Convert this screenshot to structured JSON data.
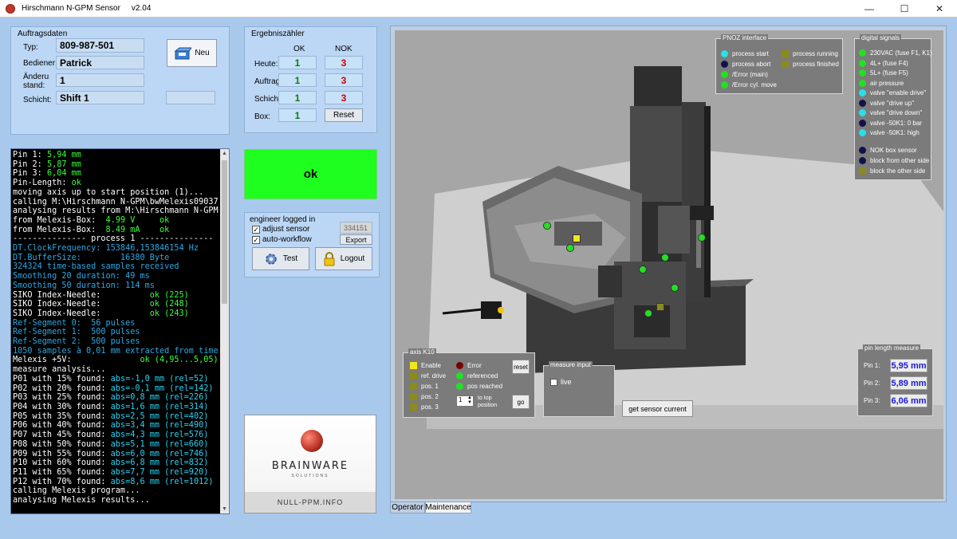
{
  "window": {
    "title": "Hirschmann N-GPM Sensor",
    "version": "v2.04",
    "minimize": "—",
    "maximize": "☐",
    "close": "✕"
  },
  "order": {
    "title": "Auftragsdaten",
    "type_label": "Typ:",
    "type_value": "809-987-501",
    "operator_label": "Bediener:",
    "operator_value": "Patrick",
    "change_label": "Änderu stand:",
    "change_value": "1",
    "shift_label": "Schicht:",
    "shift_value": "Shift 1",
    "new_button": "Neu"
  },
  "counter": {
    "title": "Ergebniszähler",
    "ok_header": "OK",
    "nok_header": "NOK",
    "rows": [
      {
        "label": "Heute:",
        "ok": "1",
        "nok": "3"
      },
      {
        "label": "Auftrag:",
        "ok": "1",
        "nok": "3"
      },
      {
        "label": "Schicht:",
        "ok": "1",
        "nok": "3"
      }
    ],
    "box_label": "Box:",
    "box_value": "1",
    "reset_button": "Reset"
  },
  "log": [
    {
      "t": "Pin 1: ",
      "c": "w",
      "v": "5,94 mm",
      "vc": "g"
    },
    {
      "t": "Pin 2: ",
      "c": "w",
      "v": "5,87 mm",
      "vc": "g"
    },
    {
      "t": "Pin 3: ",
      "c": "w",
      "v": "6,04 mm",
      "vc": "g"
    },
    {
      "t": "Pin-Length: ",
      "c": "w",
      "v": "ok",
      "vc": "g"
    },
    {
      "t": "moving axis up to start position (1)...",
      "c": "w",
      "v": "",
      "vc": "w"
    },
    {
      "t": "calling M:\\Hirschmann N-GPM\\bwMelexis09037",
      "c": "w",
      "v": "",
      "vc": "w"
    },
    {
      "t": "analysing results from M:\\Hirschmann N-GPM",
      "c": "w",
      "v": "",
      "vc": "w"
    },
    {
      "t": "from Melexis-Box:  ",
      "c": "w",
      "v": "4.99 V     ok",
      "vc": "g"
    },
    {
      "t": "from Melexis-Box:  ",
      "c": "w",
      "v": "8.49 mA    ok",
      "vc": "g"
    },
    {
      "t": "--------------- process 1 ---------------",
      "c": "w",
      "v": "",
      "vc": "w"
    },
    {
      "t": "DT.ClockFrequency: 153846,153846154 Hz",
      "c": "b",
      "v": "",
      "vc": "w"
    },
    {
      "t": "DT.BufferSize:        16380 Byte",
      "c": "b",
      "v": "",
      "vc": "w"
    },
    {
      "t": "324324 time-based samples received",
      "c": "b",
      "v": "",
      "vc": "w"
    },
    {
      "t": "Smoothing 20 duration: 49 ms",
      "c": "b",
      "v": "",
      "vc": "w"
    },
    {
      "t": "Smoothing 50 duration: 114 ms",
      "c": "b",
      "v": "",
      "vc": "w"
    },
    {
      "t": "SIKO Index-Needle:          ",
      "c": "w",
      "v": "ok (225)",
      "vc": "g"
    },
    {
      "t": "SIKO Index-Needle:          ",
      "c": "w",
      "v": "ok (248)",
      "vc": "g"
    },
    {
      "t": "SIKO Index-Needle:          ",
      "c": "w",
      "v": "ok (243)",
      "vc": "g"
    },
    {
      "t": "Ref-Segment 0:  56 pulses",
      "c": "b",
      "v": "",
      "vc": "w"
    },
    {
      "t": "Ref-Segment 1:  500 pulses",
      "c": "b",
      "v": "",
      "vc": "w"
    },
    {
      "t": "Ref-Segment 2:  500 pulses",
      "c": "b",
      "v": "",
      "vc": "w"
    },
    {
      "t": "1050 samples à 0,01 mm extracted from time",
      "c": "b",
      "v": "",
      "vc": "w"
    },
    {
      "t": "Melexis +5V:              ",
      "c": "w",
      "v": "ok (4,95...5,05)",
      "vc": "g"
    },
    {
      "t": "measure analysis...",
      "c": "w",
      "v": "",
      "vc": "w"
    },
    {
      "t": "P01 with 15% found: ",
      "c": "w",
      "v": "abs=-1,0 mm (rel=52)",
      "vc": "c"
    },
    {
      "t": "P02 with 20% found: ",
      "c": "w",
      "v": "abs=-0,1 mm (rel=142)",
      "vc": "c"
    },
    {
      "t": "P03 with 25% found: ",
      "c": "w",
      "v": "abs=0,8 mm (rel=226)",
      "vc": "c"
    },
    {
      "t": "P04 with 30% found: ",
      "c": "w",
      "v": "abs=1,6 mm (rel=314)",
      "vc": "c"
    },
    {
      "t": "P05 with 35% found: ",
      "c": "w",
      "v": "abs=2,5 mm (rel=402)",
      "vc": "c"
    },
    {
      "t": "P06 with 40% found: ",
      "c": "w",
      "v": "abs=3,4 mm (rel=490)",
      "vc": "c"
    },
    {
      "t": "P07 with 45% found: ",
      "c": "w",
      "v": "abs=4,3 mm (rel=576)",
      "vc": "c"
    },
    {
      "t": "P08 with 50% found: ",
      "c": "w",
      "v": "abs=5,1 mm (rel=660)",
      "vc": "c"
    },
    {
      "t": "P09 with 55% found: ",
      "c": "w",
      "v": "abs=6,0 mm (rel=746)",
      "vc": "c"
    },
    {
      "t": "P10 with 60% found: ",
      "c": "w",
      "v": "abs=6,8 mm (rel=832)",
      "vc": "c"
    },
    {
      "t": "P11 with 65% found: ",
      "c": "w",
      "v": "abs=7,7 mm (rel=920)",
      "vc": "c"
    },
    {
      "t": "P12 with 70% found: ",
      "c": "w",
      "v": "abs=8,6 mm (rel=1012)",
      "vc": "c"
    },
    {
      "t": "calling Melexis program...",
      "c": "w",
      "v": "",
      "vc": "w"
    },
    {
      "t": "analysing Melexis results...",
      "c": "w",
      "v": "",
      "vc": "w"
    }
  ],
  "result": {
    "text": "ok",
    "color": "#1fff1f"
  },
  "engineer": {
    "title": "engineer logged in",
    "code": "334151",
    "adjust_sensor": "adjust sensor",
    "auto_workflow": "auto-workflow",
    "export_button": "Export",
    "test_button": "Test",
    "logout_button": "Logout"
  },
  "logo": {
    "name": "BRAINWARE",
    "sub": "SOLUTIONS",
    "footer": "NULL-PPM.INFO"
  },
  "pnoz": {
    "title": "PNOZ interface",
    "items": [
      {
        "label": "process start",
        "color": "#29e0e8",
        "shape": "dot"
      },
      {
        "label": "process abort",
        "color": "#12124a",
        "shape": "dot"
      },
      {
        "label": "/Error (main)",
        "color": "#22e022",
        "shape": "dot"
      },
      {
        "label": "/Error cyl. move",
        "color": "#22e022",
        "shape": "dot"
      },
      {
        "label": "process running",
        "color": "#8a8a1e",
        "shape": "sq"
      },
      {
        "label": "process finished",
        "color": "#8a8a1e",
        "shape": "sq"
      }
    ]
  },
  "digital": {
    "title": "digital signals",
    "items": [
      {
        "label": "230VAC (fuse F1, K1)",
        "color": "#22e022",
        "shape": "dot"
      },
      {
        "label": "4L+  (fuse F4)",
        "color": "#22e022",
        "shape": "dot"
      },
      {
        "label": "5L+  (fuse F5)",
        "color": "#22e022",
        "shape": "dot"
      },
      {
        "label": "air pressure",
        "color": "#22e022",
        "shape": "dot"
      },
      {
        "label": "valve \"enable drive\"",
        "color": "#29e0e8",
        "shape": "dot"
      },
      {
        "label": "valve \"drive up\"",
        "color": "#12124a",
        "shape": "dot"
      },
      {
        "label": "valve \"drive down\"",
        "color": "#29e0e8",
        "shape": "dot"
      },
      {
        "label": "valve -50K1: 0 bar",
        "color": "#12124a",
        "shape": "dot"
      },
      {
        "label": "valve -50K1: high",
        "color": "#29e0e8",
        "shape": "dot"
      },
      {
        "label": "NOK box sensor",
        "color": "#12124a",
        "shape": "dot"
      },
      {
        "label": "block from other side",
        "color": "#12124a",
        "shape": "dot"
      },
      {
        "label": "block the other side",
        "color": "#8a8a1e",
        "shape": "sq"
      }
    ]
  },
  "axis": {
    "title": "axis K10",
    "left": [
      {
        "label": "Enable",
        "color": "#f5e51b"
      },
      {
        "label": "ref. drive",
        "color": "#8a8a1e"
      },
      {
        "label": "pos. 1",
        "color": "#8a8a1e"
      },
      {
        "label": "pos. 2",
        "color": "#8a8a1e"
      },
      {
        "label": "pos. 3",
        "color": "#8a8a1e"
      }
    ],
    "right": [
      {
        "label": "Error",
        "color": "#7a0000"
      },
      {
        "label": "referenced",
        "color": "#22e022"
      },
      {
        "label": "pos reached",
        "color": "#22e022"
      }
    ],
    "stepper_value": "1",
    "to_top": "to top position",
    "reset_button": "reset",
    "go_button": "go"
  },
  "measure_input": {
    "title": "measure input",
    "live": "live"
  },
  "get_sensor_current": "get sensor current",
  "pin_length": {
    "title": "pin length measure",
    "pins": [
      {
        "label": "Pin 1:",
        "value": "5,95 mm"
      },
      {
        "label": "Pin 2:",
        "value": "5,89 mm"
      },
      {
        "label": "Pin 3:",
        "value": "6,06 mm"
      }
    ]
  },
  "tabs": [
    "Operator",
    "Maintenance"
  ],
  "machine_indicators": [
    {
      "color": "#22e022"
    },
    {
      "color": "#f5e51b"
    },
    {
      "color": "#22e022"
    },
    {
      "color": "#22e022"
    },
    {
      "color": "#22e022"
    },
    {
      "color": "#22e022"
    },
    {
      "color": "#8a8a1e"
    },
    {
      "color": "#22e022"
    },
    {
      "color": "#22e022"
    }
  ]
}
